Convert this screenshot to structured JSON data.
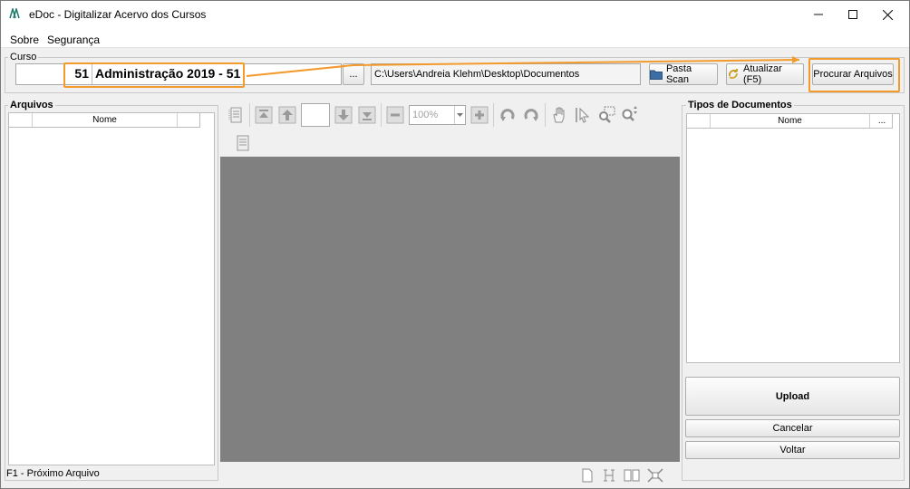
{
  "window": {
    "title": "eDoc - Digitalizar Acervo dos Cursos",
    "minimize_icon": "minimize-icon",
    "maximize_icon": "maximize-icon",
    "close_icon": "close-icon"
  },
  "menu": {
    "items": [
      "Sobre",
      "Segurança"
    ]
  },
  "curso": {
    "label": "Curso",
    "code": "51",
    "name": "Administração 2019 - 51",
    "browse_label": "...",
    "path": "C:\\Users\\Andreia Klehm\\Desktop\\Documentos",
    "pasta_scan_label": "Pasta Scan",
    "atualizar_label": "Atualizar (F5)",
    "procurar_label": "Procurar Arquivos"
  },
  "arquivos": {
    "label": "Arquivos",
    "column_nome": "Nome",
    "status": "F1 - Próximo Arquivo"
  },
  "viewer": {
    "zoom": "100%",
    "page_value": ""
  },
  "tipos": {
    "label": "Tipos de Documentos",
    "column_nome": "Nome",
    "column_more": "...",
    "upload_label": "Upload",
    "cancelar_label": "Cancelar",
    "voltar_label": "Voltar"
  },
  "colors": {
    "highlight": "#f39a2b",
    "viewer_bg": "#808080",
    "window_bg": "#f0f0f0"
  }
}
